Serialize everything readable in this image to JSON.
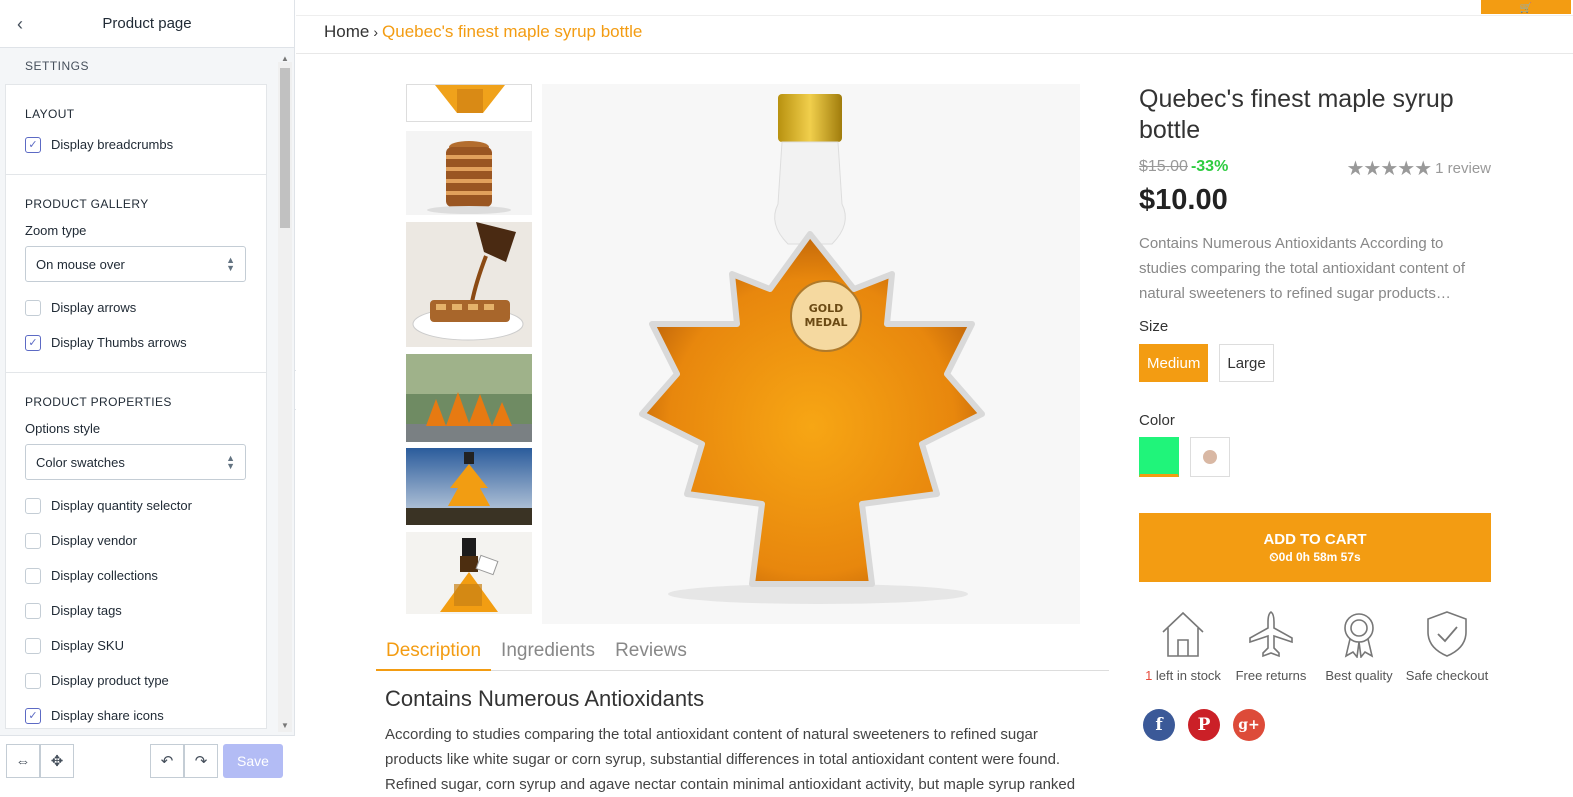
{
  "editor": {
    "title": "Product page",
    "settings_heading": "SETTINGS",
    "sections": {
      "layout": {
        "title": "LAYOUT",
        "display_breadcrumbs": "Display breadcrumbs"
      },
      "gallery": {
        "title": "PRODUCT GALLERY",
        "zoom_label": "Zoom type",
        "zoom_value": "On mouse over",
        "display_arrows": "Display arrows",
        "display_thumbs_arrows": "Display Thumbs arrows"
      },
      "properties": {
        "title": "PRODUCT PROPERTIES",
        "options_label": "Options style",
        "options_value": "Color swatches",
        "quantity": "Display quantity selector",
        "vendor": "Display vendor",
        "collections": "Display collections",
        "tags": "Display tags",
        "sku": "Display SKU",
        "product_type": "Display product type",
        "share_icons": "Display share icons"
      }
    },
    "footer": {
      "save_label": "Save"
    }
  },
  "store": {
    "breadcrumb": {
      "home": "Home",
      "sep": "›",
      "current": "Quebec's finest maple syrup bottle"
    },
    "product": {
      "title": "Quebec's finest maple syrup bottle",
      "old_price": "$15.00",
      "discount": "-33%",
      "stars": "★★★★★",
      "reviews": "1 review",
      "price": "$10.00",
      "short_desc": "Contains Numerous Antioxidants According to studies comparing the total antioxidant content of natural sweeteners to refined sugar products…",
      "size_label": "Size",
      "sizes": [
        "Medium",
        "Large"
      ],
      "color_label": "Color",
      "add_to_cart": "ADD TO CART",
      "timer": "⏲0d 0h 58m 57s",
      "features": {
        "stock_num": "1",
        "stock_text": " left in stock",
        "returns": "Free returns",
        "quality": "Best quality",
        "checkout": "Safe checkout"
      },
      "medal_text": "GOLD MEDAL"
    },
    "tabs": [
      "Description",
      "Ingredients",
      "Reviews"
    ],
    "description": {
      "heading": "Contains Numerous Antioxidants",
      "body": "According to studies comparing the total antioxidant content of natural sweeteners to refined sugar products like white sugar or corn syrup, substantial differences in total antioxidant content were found. Refined sugar, corn syrup and agave nectar contain minimal antioxidant activity, but maple syrup ranked"
    },
    "social": {
      "facebook": "f",
      "pinterest": "P",
      "google": "g+"
    },
    "colors": {
      "accent": "#f39c12",
      "swatch_green": "#20f47a",
      "facebook": "#3b5998",
      "pinterest": "#cb2027",
      "google": "#dd4b39"
    }
  }
}
